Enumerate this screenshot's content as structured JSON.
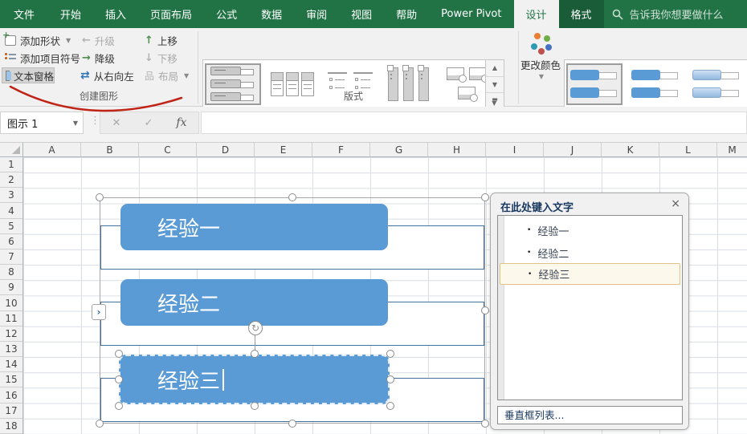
{
  "tabs": [
    "文件",
    "开始",
    "插入",
    "页面布局",
    "公式",
    "数据",
    "审阅",
    "视图",
    "帮助",
    "Power Pivot",
    "设计",
    "格式"
  ],
  "search_placeholder": "告诉我你想要做什么",
  "ribbon": {
    "create_graphic": {
      "group_label": "创建图形",
      "add_shape": "添加形状",
      "add_bullet": "添加项目符号",
      "text_pane": "文本窗格",
      "promote": "升级",
      "demote": "降级",
      "right_to_left": "从右向左",
      "move_up": "上移",
      "move_down": "下移",
      "layout": "布局"
    },
    "layouts_label": "版式",
    "change_colors": "更改颜色"
  },
  "formula_bar": {
    "name_box": "图示 1",
    "cancel": "✕",
    "enter": "✓",
    "fx": "fx"
  },
  "sheet": {
    "columns": [
      "A",
      "B",
      "C",
      "D",
      "E",
      "F",
      "G",
      "H",
      "I",
      "J",
      "K",
      "L",
      "M"
    ],
    "rows": [
      "1",
      "2",
      "3",
      "4",
      "5",
      "6",
      "7",
      "8",
      "9",
      "10",
      "11",
      "12",
      "13",
      "14",
      "15",
      "16",
      "17",
      "18"
    ]
  },
  "smartart": {
    "shape1": "经验一",
    "shape2": "经验二",
    "shape3": "经验三"
  },
  "text_pane": {
    "title": "在此处键入文字",
    "close": "×",
    "bullet": "•",
    "item1": "经验一",
    "item2": "经验二",
    "item3": "经验三",
    "footer": "垂直框列表..."
  },
  "colors": {
    "excel_green": "#217346",
    "accent_blue": "#5b9bd5",
    "bar_outline": "#41719c",
    "highlight_row_border": "#e2c184"
  }
}
